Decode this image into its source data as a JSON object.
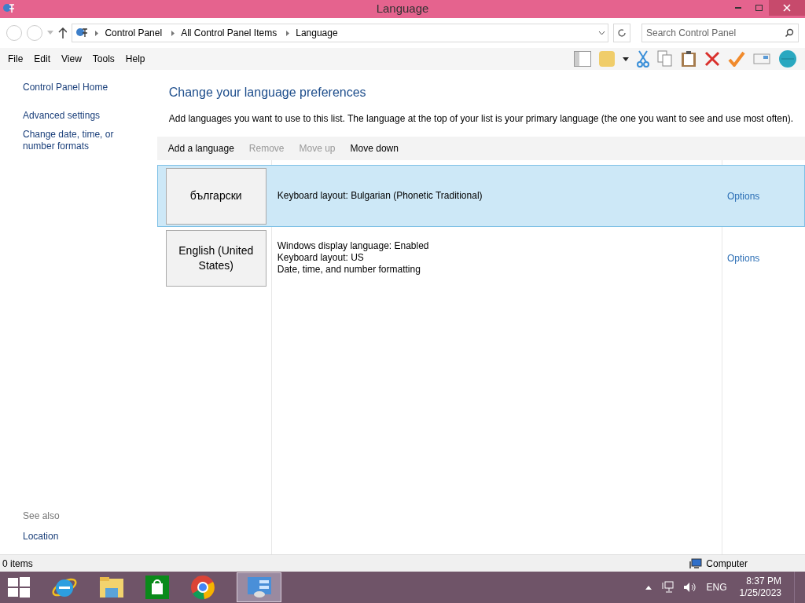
{
  "window": {
    "title": "Language"
  },
  "address": {
    "crumbs": [
      "Control Panel",
      "All Control Panel Items",
      "Language"
    ],
    "search_placeholder": "Search Control Panel"
  },
  "menu": [
    "File",
    "Edit",
    "View",
    "Tools",
    "Help"
  ],
  "sidebar": {
    "items": [
      "Control Panel Home",
      "Advanced settings",
      "Change date, time, or number formats"
    ],
    "see_also_heading": "See also",
    "see_also": [
      "Location"
    ]
  },
  "main": {
    "heading": "Change your language preferences",
    "description": "Add languages you want to use to this list. The language at the top of your list is your primary language (the one you want to see and use most often).",
    "actions": [
      {
        "label": "Add a language",
        "disabled": false
      },
      {
        "label": "Remove",
        "disabled": true
      },
      {
        "label": "Move up",
        "disabled": true
      },
      {
        "label": "Move down",
        "disabled": false
      }
    ],
    "languages": [
      {
        "name": "български",
        "details": [
          "Keyboard layout: Bulgarian (Phonetic Traditional)"
        ],
        "options": "Options",
        "selected": true
      },
      {
        "name": "English (United States)",
        "details": [
          "Windows display language: Enabled",
          "Keyboard layout: US",
          "Date, time, and number formatting"
        ],
        "options": "Options",
        "selected": false
      }
    ]
  },
  "status_bar": {
    "items": "0 items",
    "location": "Computer"
  },
  "taskbar": {
    "language": "ENG",
    "time": "8:37 PM",
    "date": "1/25/2023"
  }
}
